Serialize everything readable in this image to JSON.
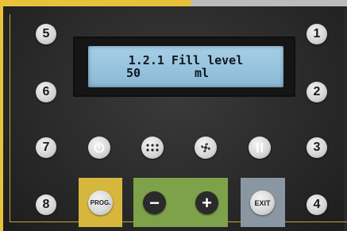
{
  "display": {
    "line1": "1.2.1 Fill level",
    "value": "50",
    "unit": "ml"
  },
  "keys": {
    "k1": "1",
    "k2": "2",
    "k3": "3",
    "k4": "4",
    "k5": "5",
    "k6": "6",
    "k7": "7",
    "k8": "8"
  },
  "buttons": {
    "prog": "PROG.",
    "minus": "−",
    "plus": "+",
    "exit": "EXIT"
  },
  "icons": {
    "power": "power-icon",
    "keypad": "dots-icon",
    "fan": "fan-icon",
    "pause": "pause-icon"
  },
  "colors": {
    "prog_highlight": "#d7b63e",
    "plus_minus_highlight": "#7ea24a",
    "exit_highlight": "#8a96a2",
    "lcd": "#97c3de"
  }
}
